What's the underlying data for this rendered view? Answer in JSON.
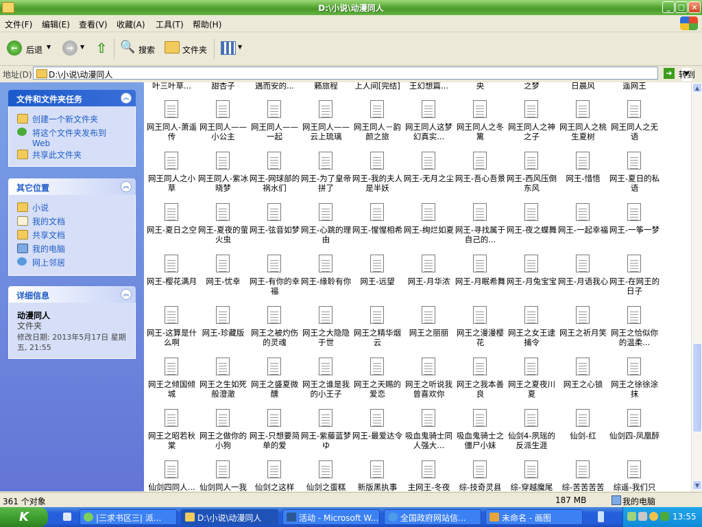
{
  "window": {
    "title": "D:\\小说\\动漫同人"
  },
  "menu": [
    "文件(F)",
    "编辑(E)",
    "查看(V)",
    "收藏(A)",
    "工具(T)",
    "帮助(H)"
  ],
  "toolbar": {
    "back": "后退",
    "search": "搜索",
    "folders": "文件夹"
  },
  "address": {
    "label": "地址(D)",
    "value": "D:\\小说\\动漫同人",
    "go": "转到"
  },
  "panels": {
    "tasks": {
      "title": "文件和文件夹任务",
      "items": [
        "创建一个新文件夹",
        "将这个文件夹发布到 Web",
        "共享此文件夹"
      ]
    },
    "places": {
      "title": "其它位置",
      "items": [
        "小说",
        "我的文档",
        "共享文档",
        "我的电脑",
        "网上邻居"
      ]
    },
    "details": {
      "title": "详细信息",
      "name": "动漫同人",
      "type": "文件夹",
      "modified": "修改日期: 2013年5月17日 星期五, 21:55"
    }
  },
  "files": {
    "row0": [
      "叶三叶草...",
      "甜杏子",
      "遇而安的...",
      "籁旅程",
      "上人间[完结]",
      "王幻想篇...",
      "央",
      "之梦",
      "日晨风",
      "遥网王"
    ],
    "rows": [
      [
        "网王同人-萧遥传",
        "网王同人——小公主",
        "网王同人——一起",
        "网王同人——云上琉璃",
        "网王同人－韵颜之旅",
        "网王同人这梦幻真实...",
        "网王同人之冬篱",
        "网王同人之神之子",
        "网王同人之桃生夏树",
        "网王同人之无语"
      ],
      [
        "网王同人之小草",
        "网王同人-紫冰晓梦",
        "网王-网球部的祸水们",
        "网王-为了皇帝拼了",
        "网王-我的夫人是半妖",
        "网王-无月之尘",
        "网王-吾心吾景",
        "网王-西风压倒东风",
        "网王-惜悟",
        "网王-夏日的私语"
      ],
      [
        "网王-夏日之空",
        "网王-夏夜的萤火虫",
        "网王-弦音如梦",
        "网王-心跳的理由",
        "网王-惺惺相希",
        "网王-绚烂如夏",
        "网王-寻找属于自己的...",
        "网王-夜之蝶舞",
        "网王-一起幸福",
        "网王-一筝一梦"
      ],
      [
        "网王-樱花满月",
        "网王-忧幸",
        "网王-有你的幸福",
        "网王-缘聆有你",
        "网王-远望",
        "网王-月华浓",
        "网王-月眠希舞",
        "网王-月兔宝宝",
        "网王-月语我心",
        "网王-在网王的日子"
      ],
      [
        "网王-这算是什么啊",
        "网王-珍藏版",
        "网王之被灼伤的灵魂",
        "网王之大隐隐于世",
        "网王之精华烟云",
        "网王之丽丽",
        "网王之漫漫樱花",
        "网王之女王逮捕令",
        "网王之祈月笑",
        "网王之恰似你的温柔..."
      ],
      [
        "网王之倾国倾城",
        "网王之生如死般澄澈",
        "网王之盛夏微醺",
        "网王之谁是我的小王子",
        "网王之天赐的爱恋",
        "网王之听说我曾喜欢你",
        "网王之我本善良",
        "网王之夏夜川夏",
        "网王之心锁",
        "网王之徐徐涂抹"
      ],
      [
        "网王之昭若秋棠",
        "网王之做你的小狗",
        "网王-只想要简单的爱",
        "网王-紫藤蓝梦ゆ",
        "网王-最爱达令",
        "吸血鬼骑士同人强大...",
        "吸血鬼骑士之僵尸小妹",
        "仙剑4-夙瑶的反派生涯",
        "仙剑-红",
        "仙剑四-凤凰醉"
      ],
      [
        "仙剑四同人...",
        "仙剑同人一我",
        "仙剑之这样",
        "仙剑之蛋糕",
        "新版黑执事",
        "主网王-冬夜",
        "综-技奇灵县",
        "综-穿越魔尾",
        "综-苦苦苦苦",
        "综遥-我们只"
      ]
    ]
  },
  "status": {
    "count": "361 个对象",
    "size": "187 MB",
    "location": "我的电脑"
  },
  "taskbar": {
    "items": [
      "|三求书区三| 派...",
      "D:\\小说\\动漫同人",
      "活动 - Microsoft W...",
      "全国政府网站信...",
      "未命名 - 画图"
    ],
    "clock": "13:55"
  }
}
